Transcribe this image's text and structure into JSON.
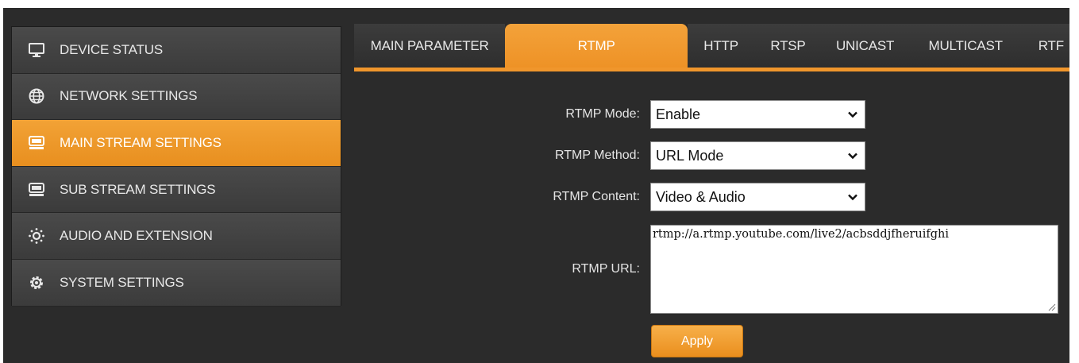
{
  "sidebar": {
    "items": [
      {
        "label": "DEVICE STATUS",
        "icon": "monitor-icon"
      },
      {
        "label": "NETWORK SETTINGS",
        "icon": "globe-icon"
      },
      {
        "label": "MAIN STREAM SETTINGS",
        "icon": "stream-icon"
      },
      {
        "label": "SUB STREAM SETTINGS",
        "icon": "stream-icon"
      },
      {
        "label": "AUDIO AND EXTENSION",
        "icon": "audio-extension-icon"
      },
      {
        "label": "SYSTEM SETTINGS",
        "icon": "gear-icon"
      }
    ],
    "active_index": 2
  },
  "tabs": {
    "items": [
      "MAIN PARAMETER",
      "RTMP",
      "HTTP",
      "RTSP",
      "UNICAST",
      "MULTICAST",
      "RTF"
    ],
    "active_index": 1
  },
  "form": {
    "rtmp_mode": {
      "label": "RTMP Mode:",
      "value": "Enable"
    },
    "rtmp_method": {
      "label": "RTMP Method:",
      "value": "URL Mode"
    },
    "rtmp_content": {
      "label": "RTMP Content:",
      "value": "Video & Audio"
    },
    "rtmp_url": {
      "label": "RTMP URL:",
      "value": "rtmp://a.rtmp.youtube.com/live2/acbsddjfheruifghi"
    },
    "apply_label": "Apply"
  },
  "colors": {
    "accent": "#f0962c",
    "background": "#2b2b2b",
    "sidebar_item": "#444444",
    "text": "#e8e8e8"
  }
}
